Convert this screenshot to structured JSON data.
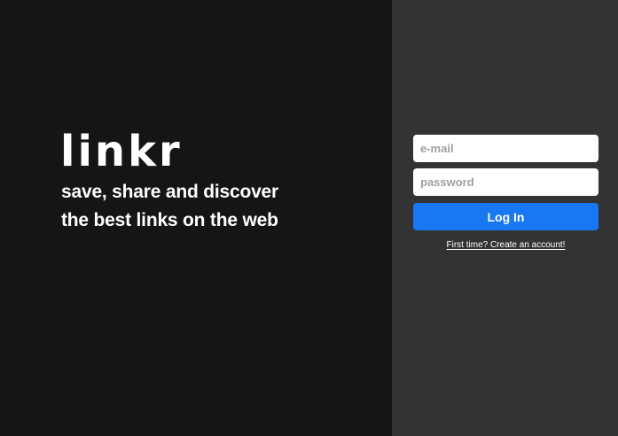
{
  "brand": {
    "logo": "linkr",
    "tagline_line1": "save, share and discover",
    "tagline_line2": "the best links on the web"
  },
  "login": {
    "email_placeholder": "e-mail",
    "email_value": "",
    "password_placeholder": "password",
    "password_value": "",
    "submit_label": "Log In",
    "signup_link": "First time? Create an account!"
  },
  "colors": {
    "hero_background": "#151515",
    "panel_background": "#333333",
    "primary_button": "#1877f2",
    "text": "#ffffff"
  }
}
